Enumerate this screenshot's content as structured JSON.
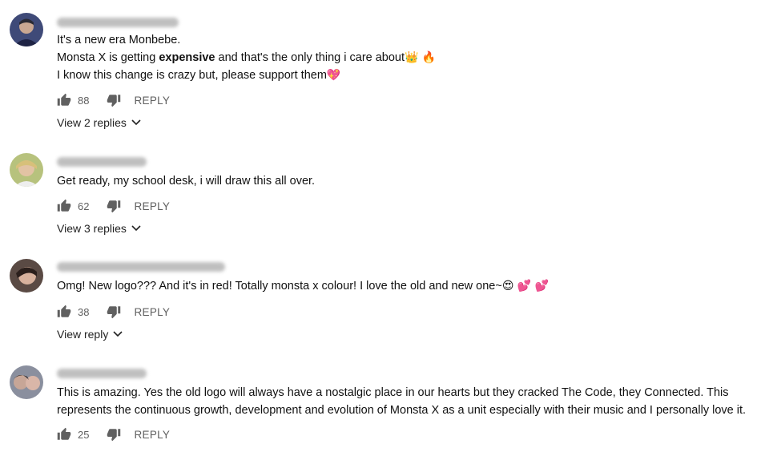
{
  "comments": [
    {
      "lines": [
        "It's a new era Monbebe.",
        "Monsta X is getting ",
        "expensive",
        " and that's the only thing i care about",
        "I know this change is crazy but, please support them"
      ],
      "emojis": {
        "line2_end": "👑 🔥",
        "line3_end": "💖"
      },
      "likes": "88",
      "reply_label": "REPLY",
      "view_replies": "View 2 replies"
    },
    {
      "lines": [
        "Get ready, my school desk, i will draw this all over."
      ],
      "likes": "62",
      "reply_label": "REPLY",
      "view_replies": "View 3 replies"
    },
    {
      "lines": [
        "Omg! New logo??? And it's in red! Totally monsta x colour! I love the old and new one~"
      ],
      "emojis": {
        "line1_end": "😍 💕 💕"
      },
      "likes": "38",
      "reply_label": "REPLY",
      "view_replies": "View reply"
    },
    {
      "lines": [
        "This is amazing. Yes the old logo will always have a nostalgic place in our hearts but they cracked The Code, they Connected. This",
        "represents the continuous growth, development and evolution of Monsta X as a unit especially with their music and I personally love it."
      ],
      "likes": "25",
      "reply_label": "REPLY"
    }
  ],
  "icons": {
    "like": "thumbs-up-icon",
    "dislike": "thumbs-down-icon",
    "expand": "chevron-down-icon"
  },
  "colors": {
    "text": "#111111",
    "meta": "#606060",
    "background": "#ffffff"
  }
}
